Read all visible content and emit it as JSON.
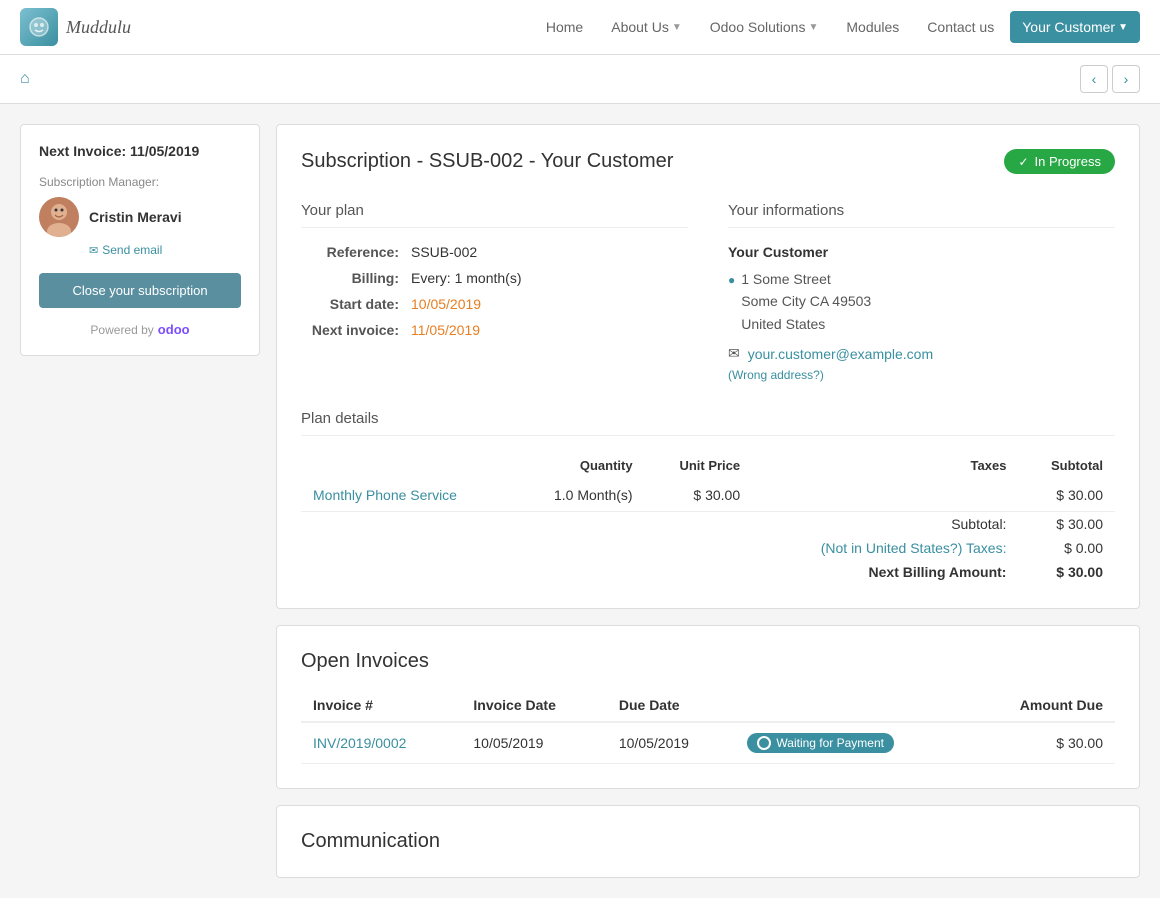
{
  "navbar": {
    "brand_name": "Muddulu",
    "items": [
      {
        "label": "Home",
        "active": false,
        "dropdown": false
      },
      {
        "label": "About Us",
        "active": false,
        "dropdown": true
      },
      {
        "label": "Odoo Solutions",
        "active": false,
        "dropdown": true
      },
      {
        "label": "Modules",
        "active": false,
        "dropdown": false
      },
      {
        "label": "Contact us",
        "active": false,
        "dropdown": false
      },
      {
        "label": "Your Customer",
        "active": true,
        "dropdown": true
      }
    ]
  },
  "subscription": {
    "prefix": "Subscription -",
    "id": "SSUB-002",
    "customer": "Your Customer",
    "title": "Subscription - SSUB-002 - Your Customer",
    "status": "In Progress",
    "your_plan_label": "Your plan",
    "reference_label": "Reference:",
    "reference_value": "SSUB-002",
    "billing_label": "Billing:",
    "billing_value": "Every: 1 month(s)",
    "start_date_label": "Start date:",
    "start_date_value": "10/05/2019",
    "next_invoice_label": "Next invoice:",
    "next_invoice_value": "11/05/2019",
    "your_info_label": "Your informations",
    "customer_name": "Your Customer",
    "address_line1": "1 Some Street",
    "address_line2": "Some City CA 49503",
    "address_line3": "United States",
    "email": "your.customer@example.com",
    "wrong_address": "(Wrong address?)",
    "plan_details_label": "Plan details",
    "table_headers": {
      "name": "",
      "quantity": "Quantity",
      "unit_price": "Unit Price",
      "taxes": "Taxes",
      "subtotal": "Subtotal"
    },
    "plan_items": [
      {
        "name": "Monthly Phone Service",
        "quantity": "1.0 Month(s)",
        "unit_price": "$ 30.00",
        "taxes": "",
        "subtotal": "$ 30.00"
      }
    ],
    "subtotal_label": "Subtotal:",
    "subtotal_value": "$ 30.00",
    "taxes_label": "(Not in United States?) Taxes:",
    "taxes_value": "$ 0.00",
    "next_billing_label": "Next Billing Amount:",
    "next_billing_value": "$ 30.00"
  },
  "sidebar": {
    "next_invoice_label": "Next Invoice: 11/05/2019",
    "manager_label": "Subscription Manager:",
    "manager_name": "Cristin Meravi",
    "send_email": "Send email",
    "close_btn": "Close your subscription",
    "powered_by": "Powered by",
    "odoo_text": "odoo"
  },
  "open_invoices": {
    "title": "Open Invoices",
    "headers": {
      "invoice_num": "Invoice #",
      "invoice_date": "Invoice Date",
      "due_date": "Due Date",
      "amount_due": "Amount Due"
    },
    "rows": [
      {
        "invoice_num": "INV/2019/0002",
        "invoice_date": "10/05/2019",
        "due_date": "10/05/2019",
        "status": "Waiting for Payment",
        "amount_due": "$ 30.00"
      }
    ]
  },
  "communication": {
    "title": "Communication"
  }
}
